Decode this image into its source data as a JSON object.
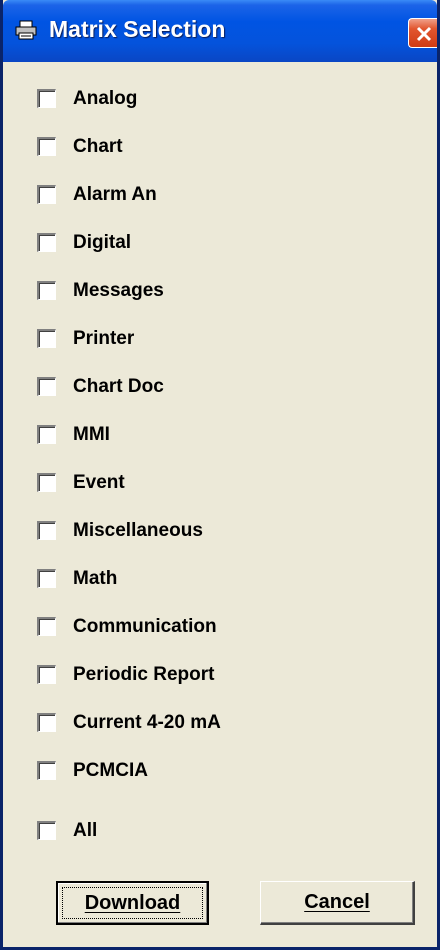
{
  "window": {
    "title": "Matrix Selection",
    "title_icon": "printer-icon",
    "close_icon": "close-icon",
    "colors": {
      "titlebar": "#0054e3",
      "close": "#e2562f",
      "dialog": "#ece9d8"
    }
  },
  "options": [
    {
      "label": "Analog",
      "checked": false
    },
    {
      "label": "Chart",
      "checked": false
    },
    {
      "label": "Alarm An",
      "checked": false
    },
    {
      "label": "Digital",
      "checked": false
    },
    {
      "label": "Messages",
      "checked": false
    },
    {
      "label": "Printer",
      "checked": false
    },
    {
      "label": "Chart Doc",
      "checked": false
    },
    {
      "label": "MMI",
      "checked": false
    },
    {
      "label": "Event",
      "checked": false
    },
    {
      "label": "Miscellaneous",
      "checked": false
    },
    {
      "label": "Math",
      "checked": false
    },
    {
      "label": "Communication",
      "checked": false
    },
    {
      "label": "Periodic Report",
      "checked": false
    },
    {
      "label": "Current 4-20 mA",
      "checked": false
    },
    {
      "label": "PCMCIA",
      "checked": false
    },
    {
      "label": "All",
      "checked": false
    }
  ],
  "buttons": {
    "download": "Download",
    "cancel": "Cancel"
  }
}
